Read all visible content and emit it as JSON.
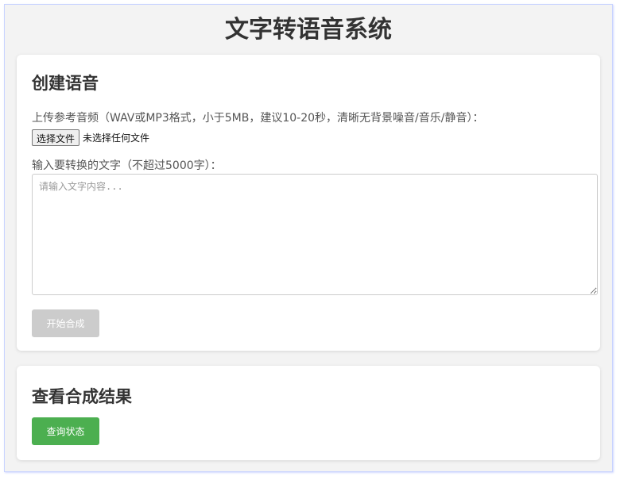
{
  "app": {
    "title": "文字转语音系统"
  },
  "create": {
    "title": "创建语音",
    "upload_label": "上传参考音频（WAV或MP3格式，小于5MB，建议10-20秒，清晰无背景噪音/音乐/静音）：",
    "file_button": "选择文件",
    "file_status": "未选择任何文件",
    "text_label": "输入要转换的文字（不超过5000字）：",
    "text_placeholder": "请输入文字内容...",
    "text_value": "",
    "start_button": "开始合成"
  },
  "result": {
    "title": "查看合成结果",
    "query_button": "查询状态"
  },
  "colors": {
    "disabled_button": "#cccccc",
    "primary_button": "#4caf50",
    "page_background": "#f3f3f3"
  }
}
